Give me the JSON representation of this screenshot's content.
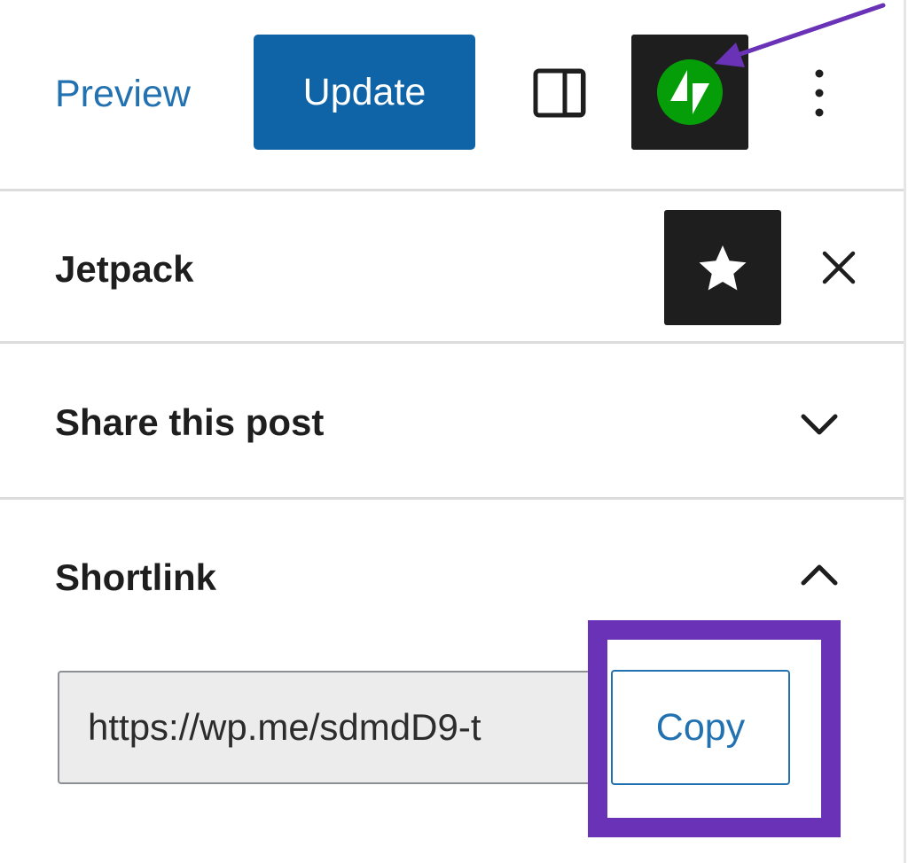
{
  "header": {
    "preview_label": "Preview",
    "update_label": "Update",
    "settings_icon": "sidebar-toggle-icon",
    "jetpack_icon": "jetpack-logo-icon",
    "more_icon": "vertical-ellipsis-icon"
  },
  "panel": {
    "title": "Jetpack",
    "star_icon": "star-icon",
    "close_icon": "close-icon",
    "sections": [
      {
        "title": "Share this post",
        "state": "collapsed",
        "chevron_icon": "chevron-down-icon"
      },
      {
        "title": "Shortlink",
        "state": "expanded",
        "chevron_icon": "chevron-up-icon"
      }
    ],
    "shortlink": {
      "value": "https://wp.me/sdmdD9-t",
      "copy_label": "Copy"
    }
  },
  "annotations": {
    "highlight_color": "#6a32b6",
    "arrow_color": "#6a32b6"
  },
  "colors": {
    "accent": "#2271b1",
    "update_bg": "#0f64a8",
    "jetpack_green": "#069e08",
    "dark_button": "#1e1e1e"
  }
}
